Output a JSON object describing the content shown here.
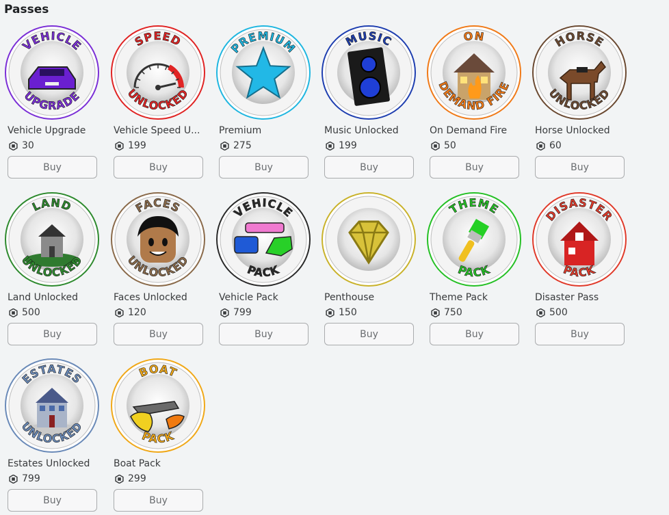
{
  "section": {
    "title": "Passes"
  },
  "currency_icon": "robux-icon",
  "passes": [
    {
      "name": "Vehicle Upgrade",
      "price": "30",
      "buy_label": "Buy",
      "badge_top": "VEHICLE",
      "badge_bottom": "UPGRADE",
      "color": "#7b2fd6",
      "icon": "purple-car-icon"
    },
    {
      "name": "Vehicle Speed U...",
      "price": "199",
      "buy_label": "Buy",
      "badge_top": "SPEED",
      "badge_bottom": "UNLOCKED",
      "color": "#e02424",
      "icon": "speedometer-icon"
    },
    {
      "name": "Premium",
      "price": "275",
      "buy_label": "Buy",
      "badge_top": "PREMIUM",
      "badge_bottom": "",
      "color": "#1fb6e0",
      "icon": "star-icon"
    },
    {
      "name": "Music Unlocked",
      "price": "199",
      "buy_label": "Buy",
      "badge_top": "MUSIC",
      "badge_bottom": "",
      "color": "#1f3fb0",
      "icon": "speaker-icon"
    },
    {
      "name": "On Demand Fire",
      "price": "50",
      "buy_label": "Buy",
      "badge_top": "ON",
      "badge_bottom": "DEMAND FIRE",
      "color": "#f07a18",
      "icon": "burning-house-icon"
    },
    {
      "name": "Horse Unlocked",
      "price": "60",
      "buy_label": "Buy",
      "badge_top": "HORSE",
      "badge_bottom": "UNLOCKED",
      "color": "#6b4a32",
      "icon": "horse-icon"
    },
    {
      "name": "Land Unlocked",
      "price": "500",
      "buy_label": "Buy",
      "badge_top": "LAND",
      "badge_bottom": "UNLOCKED",
      "color": "#2e8a2e",
      "icon": "house-on-land-icon"
    },
    {
      "name": "Faces Unlocked",
      "price": "120",
      "buy_label": "Buy",
      "badge_top": "FACES",
      "badge_bottom": "UNLOCKED",
      "color": "#8a6a4a",
      "icon": "avatar-face-icon"
    },
    {
      "name": "Vehicle Pack",
      "price": "799",
      "buy_label": "Buy",
      "badge_top": "VEHICLE",
      "badge_bottom": "PACK",
      "color": "#2a2a2a",
      "icon": "vehicles-icon"
    },
    {
      "name": "Penthouse",
      "price": "150",
      "buy_label": "Buy",
      "badge_top": "",
      "badge_bottom": "",
      "color": "#c9b22a",
      "icon": "diamond-icon"
    },
    {
      "name": "Theme Pack",
      "price": "750",
      "buy_label": "Buy",
      "badge_top": "THEME",
      "badge_bottom": "PACK",
      "color": "#25c025",
      "icon": "paintbrush-icon"
    },
    {
      "name": "Disaster Pass",
      "price": "500",
      "buy_label": "Buy",
      "badge_top": "DISASTER",
      "badge_bottom": "PACK",
      "color": "#e03a2a",
      "icon": "broken-house-icon"
    },
    {
      "name": "Estates Unlocked",
      "price": "799",
      "buy_label": "Buy",
      "badge_top": "ESTATES",
      "badge_bottom": "UNLOCKED",
      "color": "#6a8ab8",
      "icon": "mansion-icon"
    },
    {
      "name": "Boat Pack",
      "price": "299",
      "buy_label": "Buy",
      "badge_top": "BOAT",
      "badge_bottom": "PACK",
      "color": "#f0a818",
      "icon": "boats-icon"
    }
  ]
}
